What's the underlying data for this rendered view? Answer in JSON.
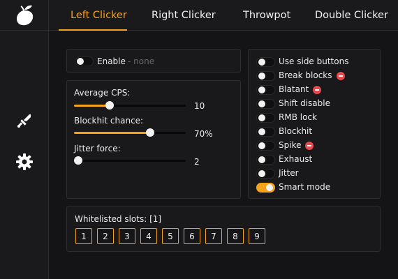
{
  "tabs": [
    "Left Clicker",
    "Right Clicker",
    "Throwpot",
    "Double Clicker"
  ],
  "active_tab": "Left Clicker",
  "sidebar": {
    "logo_icon": "mango-icon",
    "items": [
      {
        "icon": "sword-icon"
      },
      {
        "icon": "gear-icon"
      }
    ]
  },
  "enable": {
    "label": "Enable",
    "keybind": "- none",
    "on": false
  },
  "sliders": [
    {
      "label": "Average CPS:",
      "value": "10",
      "fraction": 0.32
    },
    {
      "label": "Blockhit chance:",
      "value": "70%",
      "fraction": 0.68
    },
    {
      "label": "Jitter force:",
      "value": "2",
      "fraction": 0.0
    }
  ],
  "options": [
    {
      "label": "Use side buttons",
      "on": false,
      "risky": false
    },
    {
      "label": "Break blocks",
      "on": false,
      "risky": true
    },
    {
      "label": "Blatant",
      "on": false,
      "risky": true
    },
    {
      "label": "Shift disable",
      "on": false,
      "risky": false
    },
    {
      "label": "RMB lock",
      "on": false,
      "risky": false
    },
    {
      "label": "Blockhit",
      "on": false,
      "risky": false
    },
    {
      "label": "Spike",
      "on": false,
      "risky": true
    },
    {
      "label": "Exhaust",
      "on": false,
      "risky": false
    },
    {
      "label": "Jitter",
      "on": false,
      "risky": false
    },
    {
      "label": "Smart mode",
      "on": true,
      "risky": false
    }
  ],
  "whitelist": {
    "label": "Whitelisted slots: [1]",
    "slots": [
      "1",
      "2",
      "3",
      "4",
      "5",
      "6",
      "7",
      "8",
      "9"
    ]
  },
  "colors": {
    "accent": "#f5a31a",
    "danger": "#e5484d",
    "background": "#141416"
  }
}
